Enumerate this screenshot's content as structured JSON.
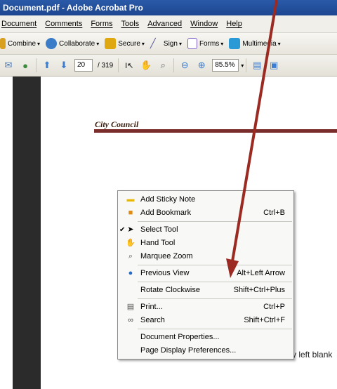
{
  "window": {
    "title": "Document.pdf - Adobe Acrobat Pro"
  },
  "menubar": [
    "Document",
    "Comments",
    "Forms",
    "Tools",
    "Advanced",
    "Window",
    "Help"
  ],
  "tasks": [
    {
      "label": "Combine",
      "icon": "combine-icon",
      "color": "#d9a020"
    },
    {
      "label": "Collaborate",
      "icon": "collaborate-icon",
      "color": "#3b7cc9"
    },
    {
      "label": "Secure",
      "icon": "lock-icon",
      "color": "#e0a810"
    },
    {
      "label": "Sign",
      "icon": "pen-icon",
      "color": "#5b5b9a"
    },
    {
      "label": "Forms",
      "icon": "forms-icon",
      "color": "#7b5ec6"
    },
    {
      "label": "Multimedia",
      "icon": "multimedia-icon",
      "color": "#2a9ad6"
    }
  ],
  "nav": {
    "page_current": "20",
    "page_total": "/ 319",
    "zoom": "85.5%"
  },
  "document": {
    "heading": "City Council",
    "blank_text": "y left blank"
  },
  "context_menu": {
    "add_sticky_note": "Add Sticky Note",
    "add_bookmark": "Add Bookmark",
    "add_bookmark_sc": "Ctrl+B",
    "select_tool": "Select Tool",
    "hand_tool": "Hand Tool",
    "marquee_zoom": "Marquee Zoom",
    "previous_view": "Previous View",
    "previous_view_sc": "Alt+Left Arrow",
    "rotate_clockwise": "Rotate Clockwise",
    "rotate_sc": "Shift+Ctrl+Plus",
    "print": "Print...",
    "print_sc": "Ctrl+P",
    "search": "Search",
    "search_sc": "Shift+Ctrl+F",
    "doc_props": "Document Properties...",
    "page_display_prefs": "Page Display Preferences..."
  },
  "colors": {
    "title_blue": "#1d4690",
    "rule_maroon": "#7a2d2a",
    "arrow_red": "#9b2a22",
    "dark_pane": "#2b2b2b"
  }
}
